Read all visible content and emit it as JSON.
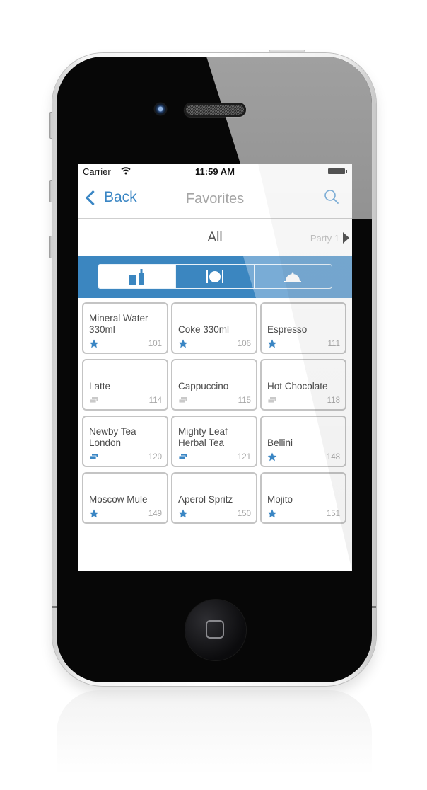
{
  "device": {
    "model_hint": "iPhone mockup"
  },
  "status_bar": {
    "carrier": "Carrier",
    "time": "11:59 AM"
  },
  "nav": {
    "back_label": "Back",
    "title": "Favorites",
    "search_icon": "search-icon"
  },
  "filter": {
    "current": "All",
    "party_label": "Party 1"
  },
  "segments": [
    {
      "name": "drinks",
      "icon": "glass-bottle-icon",
      "active": true
    },
    {
      "name": "food",
      "icon": "fork-plate-knife-icon",
      "active": false
    },
    {
      "name": "service",
      "icon": "cloche-icon",
      "active": false
    }
  ],
  "colors": {
    "accent": "#3a86c4",
    "band": "#3b86c0",
    "band_glare": "#79acd6",
    "title_gray": "#a5a5a5",
    "tile_border": "#c4c4c4"
  },
  "items": [
    {
      "name": "Mineral Water 330ml",
      "number": "101",
      "icon": "star",
      "icon_active": true
    },
    {
      "name": "Coke 330ml",
      "number": "106",
      "icon": "star",
      "icon_active": true
    },
    {
      "name": "Espresso",
      "number": "111",
      "icon": "star",
      "icon_active": true
    },
    {
      "name": "Latte",
      "number": "114",
      "icon": "cards",
      "icon_active": false
    },
    {
      "name": "Cappuccino",
      "number": "115",
      "icon": "cards",
      "icon_active": false
    },
    {
      "name": "Hot Chocolate",
      "number": "118",
      "icon": "cards",
      "icon_active": false
    },
    {
      "name": "Newby Tea London",
      "number": "120",
      "icon": "cards",
      "icon_active": true
    },
    {
      "name": "Mighty Leaf Herbal Tea",
      "number": "121",
      "icon": "cards",
      "icon_active": true
    },
    {
      "name": "Bellini",
      "number": "148",
      "icon": "star",
      "icon_active": true
    },
    {
      "name": "Moscow Mule",
      "number": "149",
      "icon": "star",
      "icon_active": true
    },
    {
      "name": "Aperol Spritz",
      "number": "150",
      "icon": "star",
      "icon_active": true
    },
    {
      "name": "Mojito",
      "number": "151",
      "icon": "star",
      "icon_active": true
    }
  ]
}
